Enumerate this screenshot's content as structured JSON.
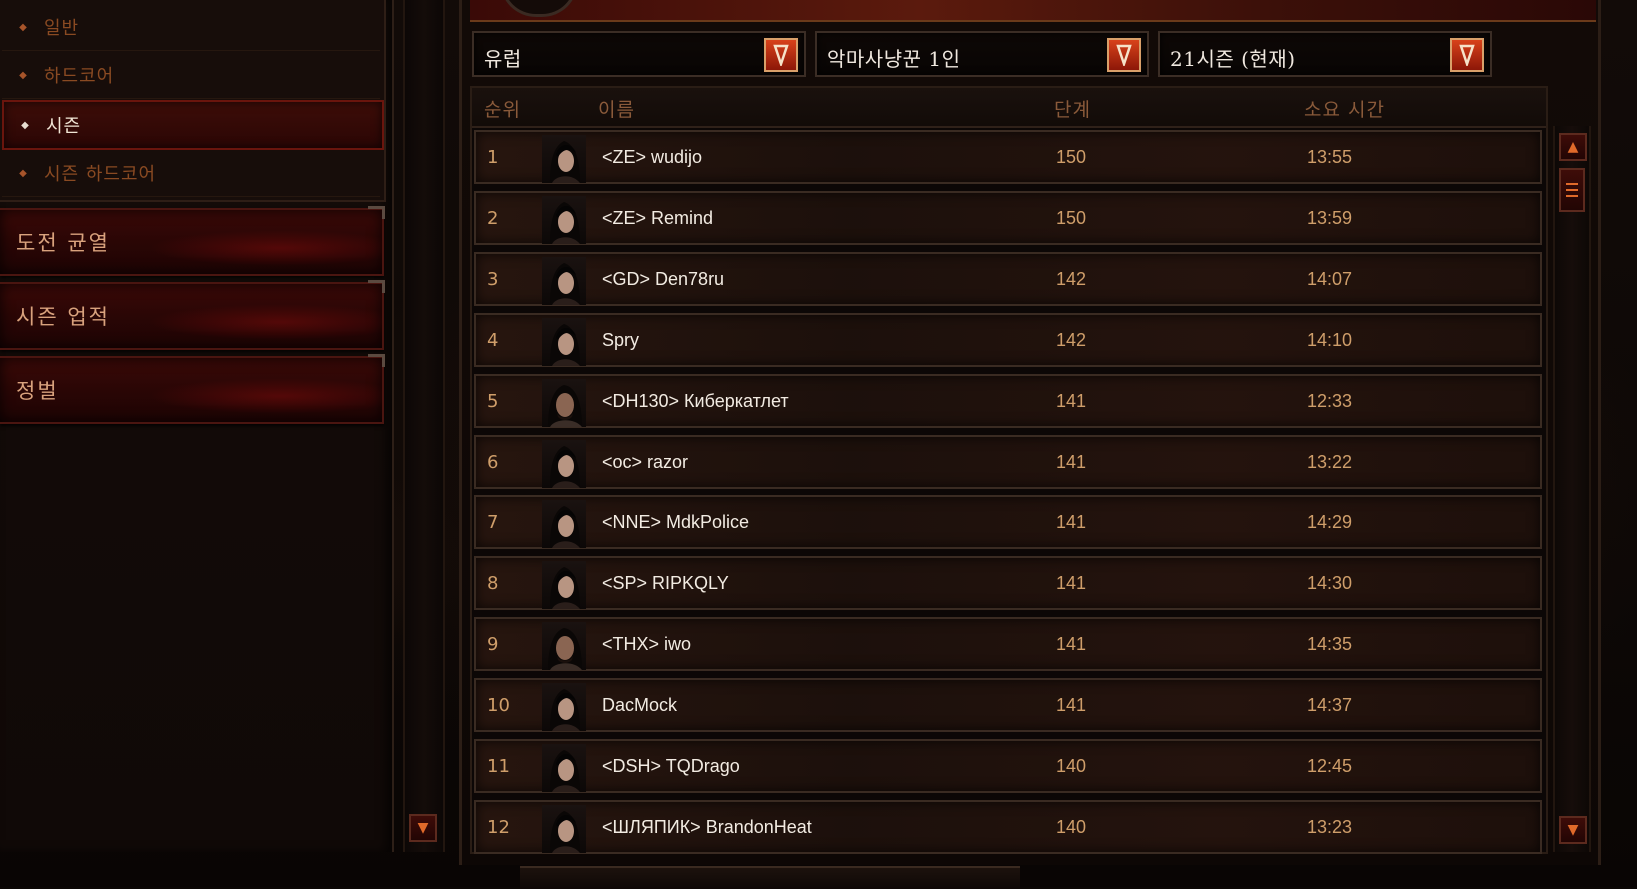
{
  "left_menu": {
    "subitems": [
      {
        "label": "일반",
        "active": false
      },
      {
        "label": "하드코어",
        "active": false
      },
      {
        "label": "시즌",
        "active": true
      },
      {
        "label": "시즌 하드코어",
        "active": false
      }
    ],
    "buttons": [
      {
        "label": "도전 균열"
      },
      {
        "label": "시즌 업적"
      },
      {
        "label": "정벌"
      }
    ]
  },
  "filters": {
    "region": "유럽",
    "category": "악마사냥꾼 1인",
    "season": "21시즌 (현재)"
  },
  "table": {
    "headers": {
      "rank": "순위",
      "name": "이름",
      "level": "단계",
      "time": "소요 시간"
    },
    "rows": [
      {
        "rank": "1",
        "name": "<ZE> wudijo",
        "level": "150",
        "time": "13:55",
        "avatar": "female"
      },
      {
        "rank": "2",
        "name": "<ZE> Remind",
        "level": "150",
        "time": "13:59",
        "avatar": "female"
      },
      {
        "rank": "3",
        "name": "<GD> Den78ru",
        "level": "142",
        "time": "14:07",
        "avatar": "female"
      },
      {
        "rank": "4",
        "name": "Spry",
        "level": "142",
        "time": "14:10",
        "avatar": "female"
      },
      {
        "rank": "5",
        "name": "<DH130> Киберкатлет",
        "level": "141",
        "time": "12:33",
        "avatar": "male"
      },
      {
        "rank": "6",
        "name": "<oc> razor",
        "level": "141",
        "time": "13:22",
        "avatar": "female"
      },
      {
        "rank": "7",
        "name": "<NNE> MdkPolice",
        "level": "141",
        "time": "14:29",
        "avatar": "female"
      },
      {
        "rank": "8",
        "name": "<SP> RIPKQLY",
        "level": "141",
        "time": "14:30",
        "avatar": "female"
      },
      {
        "rank": "9",
        "name": "<THX> iwo",
        "level": "141",
        "time": "14:35",
        "avatar": "male"
      },
      {
        "rank": "10",
        "name": "DacMock",
        "level": "141",
        "time": "14:37",
        "avatar": "female"
      },
      {
        "rank": "11",
        "name": "<DSH> TQDrago",
        "level": "140",
        "time": "12:45",
        "avatar": "female"
      },
      {
        "rank": "12",
        "name": "<ШЛЯПИК> BrandonHeat",
        "level": "140",
        "time": "13:23",
        "avatar": "female"
      }
    ]
  },
  "colors": {
    "accent": "#d8421a",
    "rank_text": "#cf9e6a",
    "name_text": "#f2ebe2",
    "menu_inactive": "#8a4a22"
  },
  "icons": {
    "dropdown": "chevron-down-icon",
    "scroll_up": "arrow-up-icon",
    "scroll_down": "arrow-down-icon",
    "scroll_thumb": "grip-icon"
  }
}
